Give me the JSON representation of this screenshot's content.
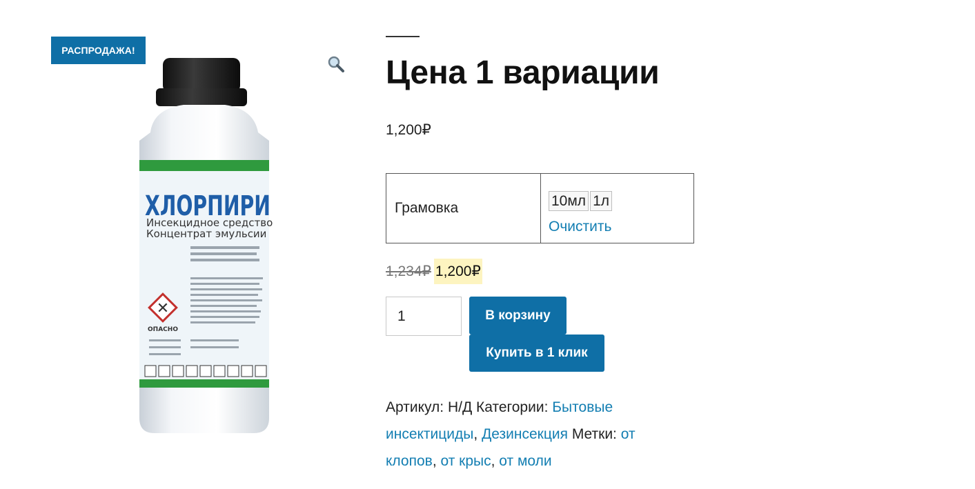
{
  "badge": {
    "sale": "РАСПРОДАЖА!"
  },
  "icons": {
    "zoom": "magnifier-icon"
  },
  "product_image": {
    "brand": "ХЛОРПИРИ",
    "line1": "Инсекцидное средство",
    "line2": "Концентрат эмульсии",
    "danger_label": "ОПАСНО",
    "colors": {
      "band": "#2f9a3e",
      "cap": "#1e1e1e",
      "body": "#f2f4f7"
    }
  },
  "product": {
    "title": "Цена 1 вариации",
    "base_price": "1,200₽"
  },
  "variations": {
    "label": "Грамовка",
    "options": [
      "10мл",
      "1л"
    ],
    "clear": "Очистить"
  },
  "price": {
    "old": "1,234₽",
    "new": "1,200₽"
  },
  "cart": {
    "quantity": "1",
    "add_to_cart": "В корзину",
    "buy_one_click": "Купить в 1 клик"
  },
  "meta": {
    "sku_label": "Артикул:",
    "sku_value": "Н/Д",
    "categories_label": "Категории:",
    "categories": [
      "Бытовые инсектициды",
      "Дезинсекция"
    ],
    "tags_label": "Метки:",
    "tags": [
      "от клопов",
      "от крыс",
      "от моли"
    ]
  },
  "colors": {
    "accent": "#0f6fa6",
    "link": "#137eb2",
    "highlight": "#fdf4c0"
  }
}
